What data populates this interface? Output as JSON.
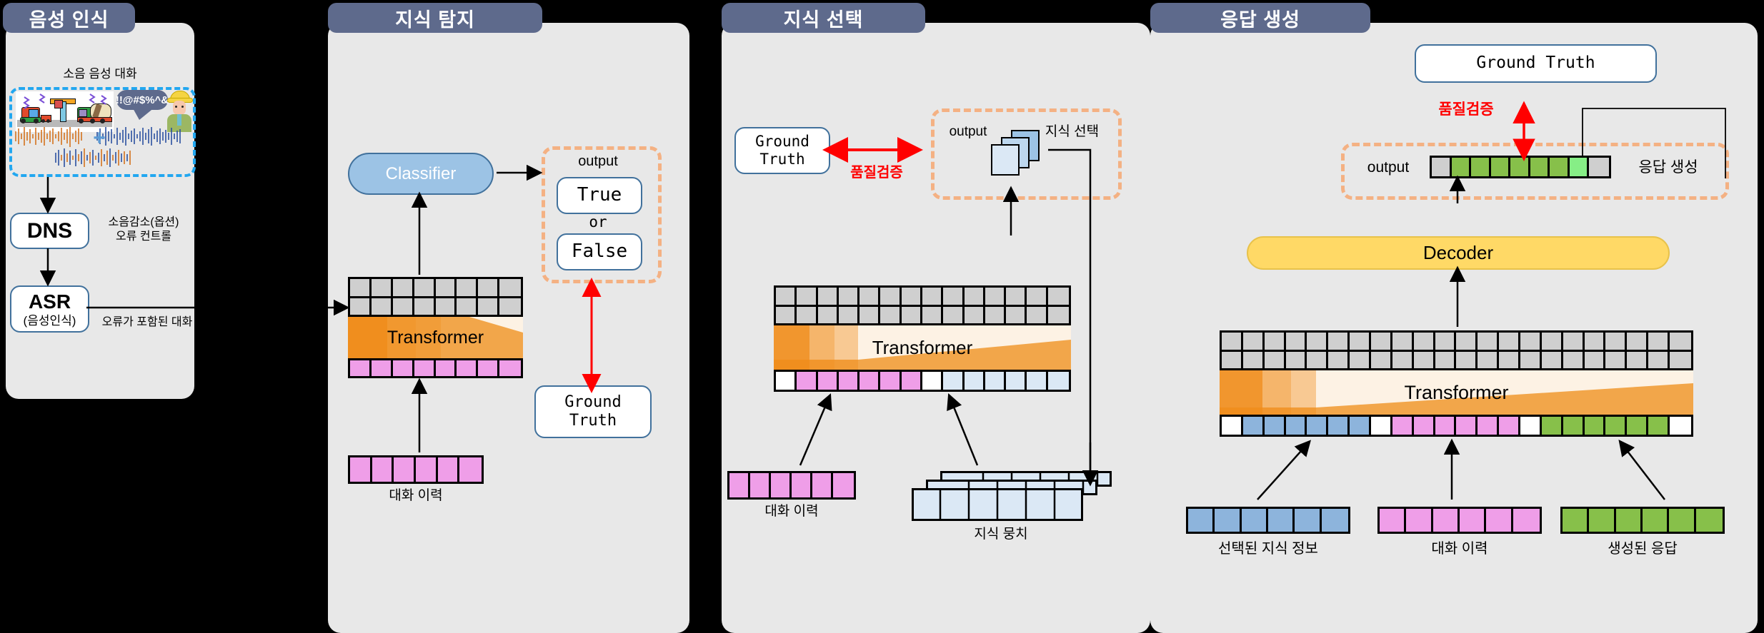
{
  "panels": [
    {
      "id": "speech-recognition",
      "title": "음성 인식",
      "caption": "소음 음성 대화",
      "bubble_text": "!!@#$%^&",
      "dns_label": "DNS",
      "dns_note_line1": "소음감소(옵션)",
      "dns_note_line2": "오류 컨트롤",
      "asr_label": "ASR",
      "asr_sub": "(음성인식)",
      "edge_label": "오류가 포함된 대화"
    },
    {
      "id": "knowledge-detection",
      "title": "지식 탐지",
      "classifier_label": "Classifier",
      "output_label": "output",
      "true_label": "True",
      "or_label": "or",
      "false_label": "False",
      "ground_truth_line1": "Ground",
      "ground_truth_line2": "Truth",
      "transformer_label": "Transformer",
      "history_label": "대화 이력"
    },
    {
      "id": "knowledge-selection",
      "title": "지식 선택",
      "ground_truth_line1": "Ground",
      "ground_truth_line2": "Truth",
      "quality_label": "품질검증",
      "output_label": "output",
      "selection_label": "지식 선택",
      "transformer_label": "Transformer",
      "history_label": "대화 이력",
      "knowledge_label": "지식 뭉치"
    },
    {
      "id": "response-generation",
      "title": "응답 생성",
      "ground_truth_label": "Ground Truth",
      "quality_label": "품질검증",
      "output_label": "output",
      "response_label": "응답 생성",
      "decoder_label": "Decoder",
      "transformer_label": "Transformer",
      "selected_knowledge_label": "선택된 지식 정보",
      "history_label": "대화 이력",
      "generated_response_label": "생성된 응답"
    }
  ],
  "colors": {
    "panel_bg": "#e8e8e8",
    "title_bg": "#5e6a8c",
    "transformer": "#f2a64a",
    "decoder": "#ffd966",
    "classifier": "#9cc3e5",
    "pink_cell": "#ef9ee8",
    "blue_cell": "#8db4dc",
    "light_blue_cell": "#dbe8f5",
    "green_cell": "#87c04a",
    "bright_green_cell": "#86ee86",
    "grey_cell": "#cfcfcf",
    "accent_red": "#ff0000",
    "dash_orange": "#f4b183",
    "dash_blue": "#22a7f0",
    "box_border": "#41719c"
  },
  "strips": {
    "p2_transformer_bottom": [
      "pink",
      "pink",
      "pink",
      "pink",
      "pink",
      "pink",
      "pink",
      "pink"
    ],
    "p2_history": [
      "pink",
      "pink",
      "pink",
      "pink",
      "pink",
      "pink"
    ],
    "p3_transformer_bottom": [
      "white",
      "pink",
      "pink",
      "pink",
      "pink",
      "pink",
      "pink",
      "white",
      "lblue",
      "lblue",
      "lblue",
      "lblue",
      "lblue",
      "lblue"
    ],
    "p3_history": [
      "pink",
      "pink",
      "pink",
      "pink",
      "pink",
      "pink"
    ],
    "p4_output": [
      "grey",
      "green",
      "green",
      "green",
      "green",
      "green",
      "green",
      "bgreen",
      "grey"
    ],
    "p4_transformer_bottom": [
      "white",
      "blue",
      "blue",
      "blue",
      "blue",
      "blue",
      "blue",
      "white",
      "pink",
      "pink",
      "pink",
      "pink",
      "pink",
      "pink",
      "white",
      "green",
      "green",
      "green",
      "green",
      "green",
      "green",
      "white"
    ],
    "p4_selected_knowledge": [
      "blue",
      "blue",
      "blue",
      "blue",
      "blue",
      "blue"
    ],
    "p4_history": [
      "pink",
      "pink",
      "pink",
      "pink",
      "pink",
      "pink"
    ],
    "p4_generated": [
      "green",
      "green",
      "green",
      "green",
      "green",
      "green"
    ]
  },
  "grids": {
    "p2_top": {
      "rows": 2,
      "cols": 8
    },
    "p3_top": {
      "rows": 2,
      "cols": 14
    },
    "p4_top": {
      "rows": 2,
      "cols": 22
    }
  }
}
